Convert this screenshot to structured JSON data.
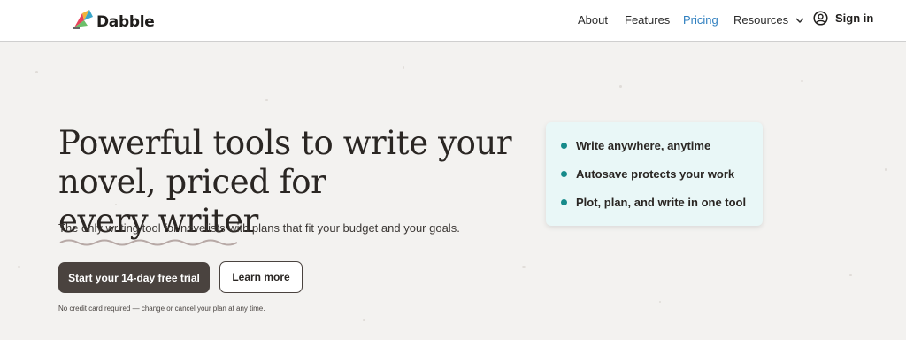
{
  "brand": {
    "name": "Dabble"
  },
  "nav": {
    "items": [
      {
        "label": "About"
      },
      {
        "label": "Features"
      },
      {
        "label": "Pricing",
        "active": true
      },
      {
        "label": "Resources"
      }
    ],
    "signin_label": "Sign in"
  },
  "hero": {
    "headline_part1": "Powerful tools to write your novel, priced for",
    "headline_emph": "every writer",
    "subtext": "The only writing tool for novelists with plans that fit your budget and your goals.",
    "primary_button": "Start your 14-day free trial",
    "secondary_button": "Learn more",
    "fineprint": "No credit card required — change or cancel your plan at any time."
  },
  "features": [
    {
      "label": "Write anywhere, anytime"
    },
    {
      "label": "Autosave protects your work"
    },
    {
      "label": "Plot, plan, and write in one tool"
    }
  ],
  "colors": {
    "accent": "#2f7fbf",
    "button_dark": "#4a433f",
    "bullet_teal": "#168a8a",
    "card_bg": "#e9f7f7",
    "page_bg": "#f3f2f0"
  },
  "icons": [
    "dabble-logo-icon",
    "chevron-down-icon",
    "user-circle-icon"
  ]
}
